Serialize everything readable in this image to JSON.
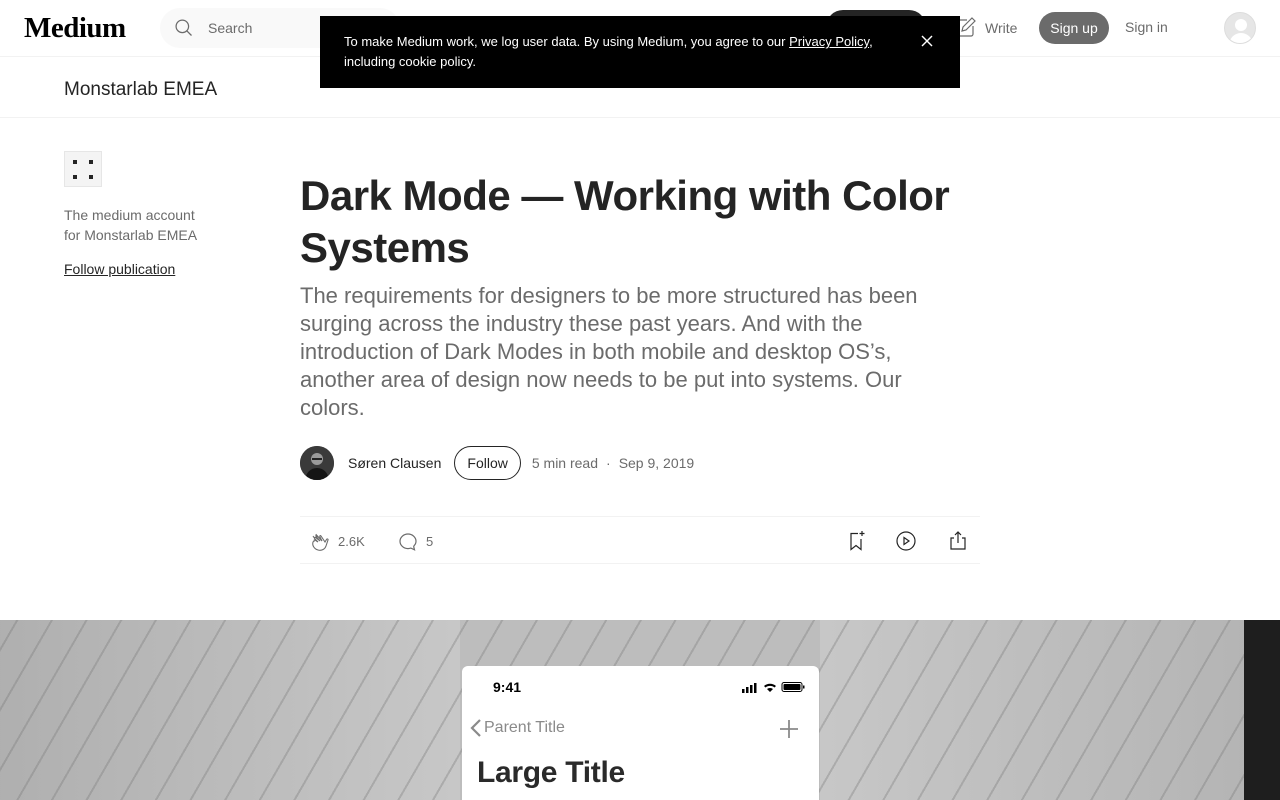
{
  "nav": {
    "logo": "Medium",
    "search_placeholder": "Search",
    "write_label": "Write",
    "signup_label": "Sign up",
    "signin_label": "Sign in"
  },
  "cookie_banner": {
    "text_before": "To make Medium work, we log user data. By using Medium, you agree to our ",
    "link_text": "Privacy Policy",
    "text_after": ", including cookie policy."
  },
  "publication": {
    "name": "Monstarlab EMEA",
    "description": "The medium account for Monstarlab EMEA",
    "follow_label": "Follow publication"
  },
  "article": {
    "title": "Dark Mode — Working with Color Systems",
    "subtitle": "The requirements for designers to be more structured has been surging across the industry these past years. And with the introduction of Dark Modes in both mobile and desktop OS’s, another area of design now needs to be put into systems. Our colors.",
    "author": "Søren Clausen",
    "follow_label": "Follow",
    "read_time": "5 min read",
    "separator": "·",
    "date": "Sep 9, 2019",
    "claps": "2.6K",
    "responses": "5"
  },
  "hero_phone": {
    "time": "9:41",
    "back_label": "Parent Title",
    "large_title": "Large Title"
  }
}
